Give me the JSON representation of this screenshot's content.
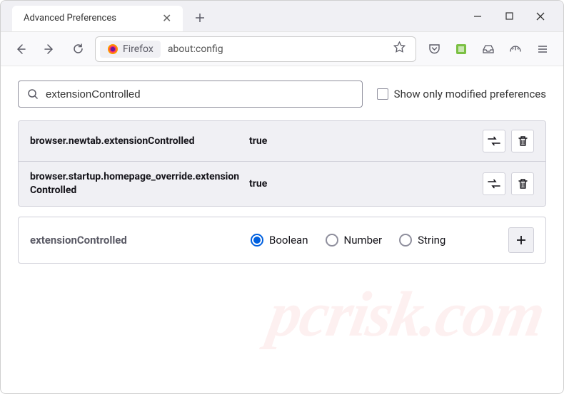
{
  "window": {
    "tab_title": "Advanced Preferences"
  },
  "toolbar": {
    "identity_label": "Firefox",
    "url": "about:config"
  },
  "search": {
    "value": "extensionControlled",
    "checkbox_label": "Show only modified preferences"
  },
  "prefs": [
    {
      "name": "browser.newtab.extensionControlled",
      "value": "true"
    },
    {
      "name": "browser.startup.homepage_override.extensionControlled",
      "value": "true"
    }
  ],
  "new_pref": {
    "name": "extensionControlled",
    "types": [
      "Boolean",
      "Number",
      "String"
    ],
    "selected": 0
  },
  "watermark": "pcrisk.com"
}
